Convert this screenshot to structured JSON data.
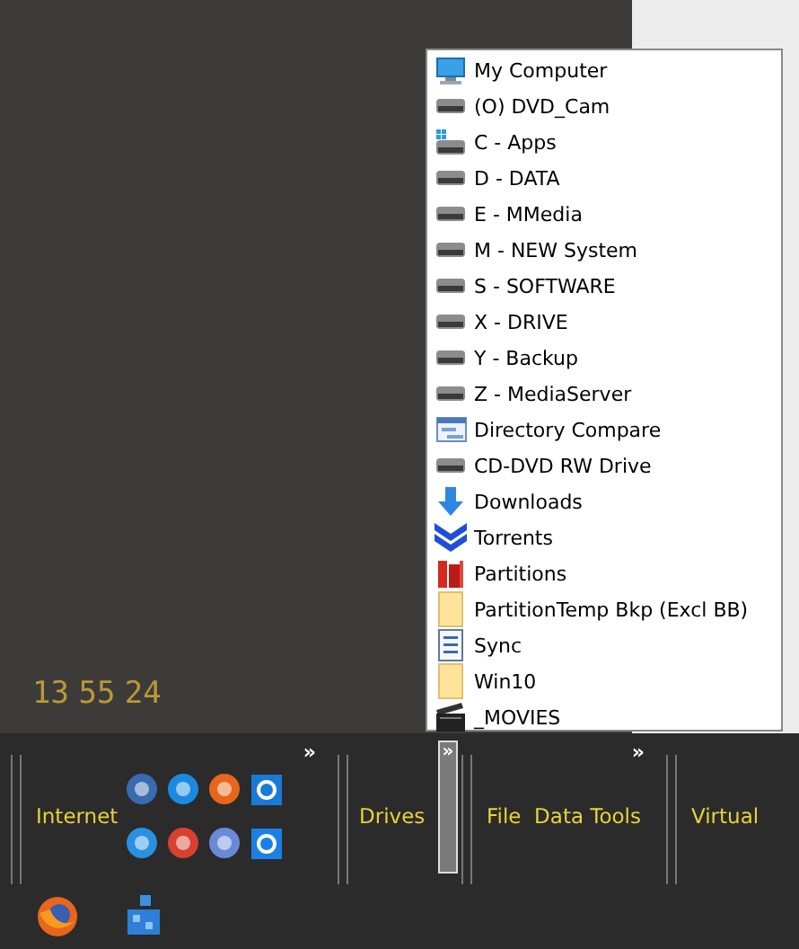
{
  "clock": "13 55 24",
  "menu": {
    "items": [
      {
        "label": "My Computer",
        "kind": "computer"
      },
      {
        "label": "(O) DVD_Cam",
        "kind": "drive"
      },
      {
        "label": "C - Apps",
        "kind": "system-drive"
      },
      {
        "label": "D - DATA",
        "kind": "drive"
      },
      {
        "label": "E - MMedia",
        "kind": "drive"
      },
      {
        "label": "M - NEW System",
        "kind": "drive"
      },
      {
        "label": "S - SOFTWARE",
        "kind": "drive"
      },
      {
        "label": "X - DRIVE",
        "kind": "drive"
      },
      {
        "label": "Y - Backup",
        "kind": "drive"
      },
      {
        "label": "Z - MediaServer",
        "kind": "drive"
      },
      {
        "label": "Directory Compare",
        "kind": "compare"
      },
      {
        "label": "CD-DVD RW Drive",
        "kind": "drive"
      },
      {
        "label": "Downloads",
        "kind": "download"
      },
      {
        "label": "Torrents",
        "kind": "torrents"
      },
      {
        "label": "Partitions",
        "kind": "partitions"
      },
      {
        "label": "PartitionTemp Bkp (Excl BB)",
        "kind": "folder"
      },
      {
        "label": "Sync",
        "kind": "document"
      },
      {
        "label": "Win10",
        "kind": "folder"
      },
      {
        "label": "_MOVIES",
        "kind": "film"
      }
    ]
  },
  "toolbar": {
    "groups": [
      {
        "label": "Internet",
        "kind": "icons",
        "chevron": "»"
      },
      {
        "label": "Drives",
        "kind": "menu-open",
        "chevron": "»"
      },
      {
        "label": "File  Data Tools",
        "kind": "plain",
        "chevron": "»"
      },
      {
        "label": "Virtual",
        "kind": "plain"
      }
    ]
  }
}
